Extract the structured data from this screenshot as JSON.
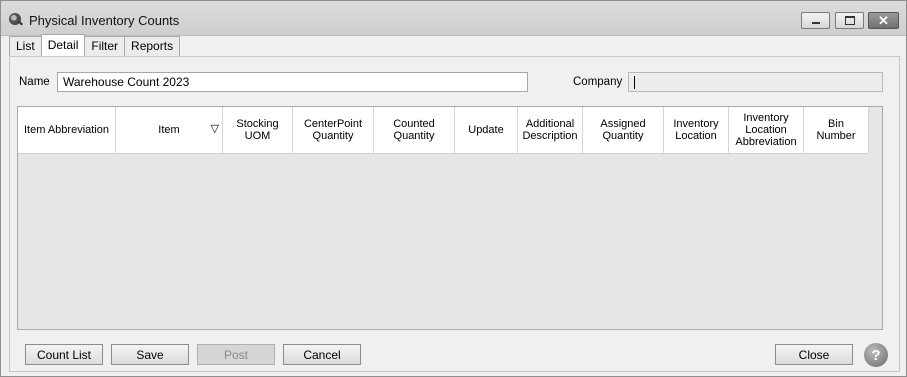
{
  "window": {
    "title": "Physical Inventory Counts",
    "icon": "app-magnifier-icon"
  },
  "tabs": [
    {
      "label": "List",
      "active": false
    },
    {
      "label": "Detail",
      "active": true
    },
    {
      "label": "Filter",
      "active": false
    },
    {
      "label": "Reports",
      "active": false
    }
  ],
  "form": {
    "name_label": "Name",
    "name_value": "Warehouse Count 2023",
    "company_label": "Company",
    "company_value": ""
  },
  "grid": {
    "columns": [
      {
        "label": "Item Abbreviation"
      },
      {
        "label": "Item"
      },
      {
        "label": "Stocking\nUOM"
      },
      {
        "label": "CenterPoint\nQuantity"
      },
      {
        "label": "Counted\nQuantity"
      },
      {
        "label": "Update"
      },
      {
        "label": "Additional\nDescription"
      },
      {
        "label": "Assigned\nQuantity"
      },
      {
        "label": "Inventory\nLocation"
      },
      {
        "label": "Inventory\nLocation\nAbbreviation"
      },
      {
        "label": "Bin\nNumber"
      }
    ],
    "filter_icon": "filter-triangle-icon",
    "rows": []
  },
  "buttons": {
    "count_list": "Count List",
    "save": "Save",
    "post": "Post",
    "cancel": "Cancel",
    "close": "Close",
    "help": "?"
  }
}
